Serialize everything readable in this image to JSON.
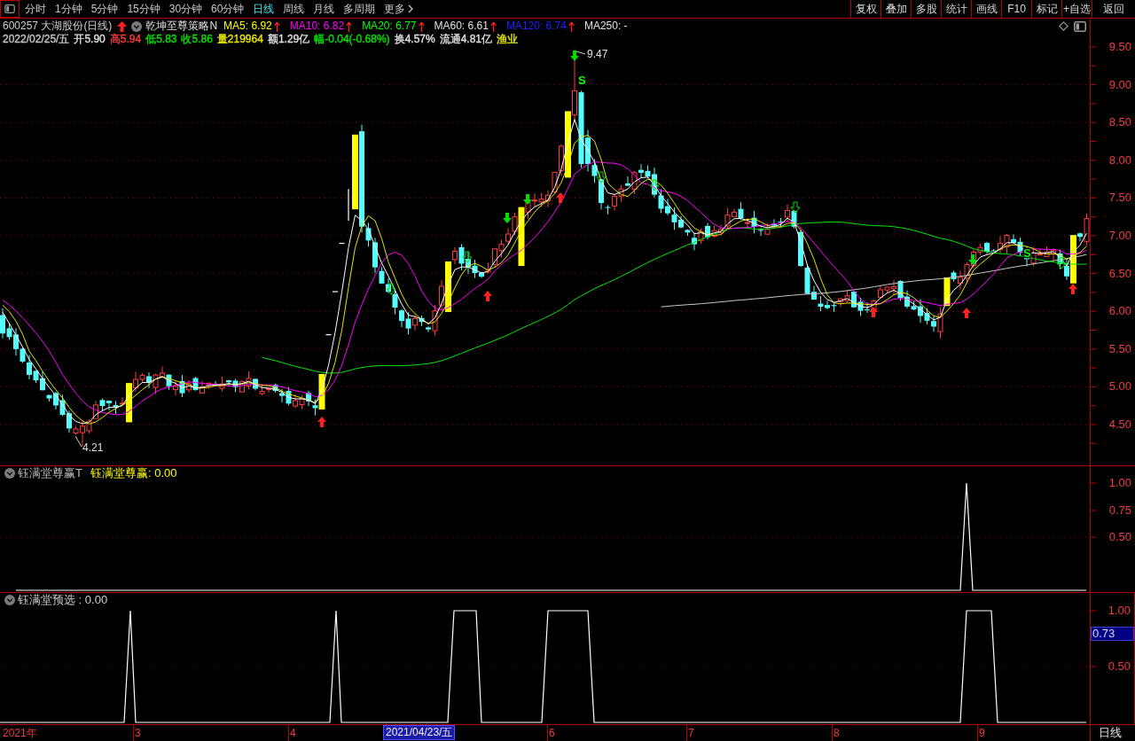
{
  "toolbar": {
    "periods": [
      {
        "label": "分时",
        "selected": false
      },
      {
        "label": "1分钟",
        "selected": false
      },
      {
        "label": "5分钟",
        "selected": false
      },
      {
        "label": "15分钟",
        "selected": false
      },
      {
        "label": "30分钟",
        "selected": false
      },
      {
        "label": "60分钟",
        "selected": false
      },
      {
        "label": "日线",
        "selected": true
      },
      {
        "label": "周线",
        "selected": false
      },
      {
        "label": "月线",
        "selected": false
      },
      {
        "label": "多周期",
        "selected": false
      }
    ],
    "more": "更多",
    "tools": [
      "复权",
      "叠加",
      "多股",
      "统计",
      "画线",
      "F10",
      "标记",
      "+自选",
      "返回"
    ]
  },
  "header": {
    "stock": "600257 大湖股份(日线)",
    "strategy": "乾坤至尊策略N",
    "averages": [
      {
        "label": "MA5: 6.92",
        "color": "#ffff00",
        "rising": true
      },
      {
        "label": "MA10: 6.82",
        "color": "#ff00ff",
        "rising": true
      },
      {
        "label": "MA20: 6.77",
        "color": "#00ff00",
        "rising": true
      },
      {
        "label": "MA60: 6.61",
        "color": "#e0e0e0",
        "rising": true
      },
      {
        "label": "MA120: 6.74",
        "color": "#2020ff",
        "rising": true
      },
      {
        "label": "MA250: -",
        "color": "#e0e0e0",
        "rising": false
      }
    ]
  },
  "quote": [
    {
      "text": "2022/02/25/五",
      "color": "#c8c8c8"
    },
    {
      "text": "开5.90",
      "color": "#e0e0e0"
    },
    {
      "text": "高5.94",
      "color": "#ff3c3c"
    },
    {
      "text": "低5.83",
      "color": "#00e600"
    },
    {
      "text": "收5.86",
      "color": "#00e600"
    },
    {
      "text": "量219964",
      "color": "#e6e600"
    },
    {
      "text": "额1.29亿",
      "color": "#e0e0e0"
    },
    {
      "text": "幅-0.04(-0.68%)",
      "color": "#00e600"
    },
    {
      "text": "换4.57%",
      "color": "#e0e0e0"
    },
    {
      "text": "流通4.81亿",
      "color": "#e0e0e0"
    },
    {
      "text": "渔业",
      "color": "#e6e600"
    }
  ],
  "price_chart": {
    "axis": [
      "9.50",
      "9.00",
      "8.50",
      "8.00",
      "7.50",
      "7.00",
      "6.50",
      "6.00",
      "5.50",
      "5.00",
      "4.50"
    ],
    "annotations": [
      "9.47",
      "4.21"
    ],
    "signal_letters": [
      "S",
      "S"
    ]
  },
  "indicator_1": {
    "name": "钰满堂尊赢T",
    "reading": "钰满堂尊赢: 0.00",
    "axis": [
      "1.00",
      "0.75",
      "0.50"
    ]
  },
  "indicator_2": {
    "name": "钰满堂预选 : 0.00",
    "axis": [
      "1.00",
      "0.50"
    ],
    "cursor_value": "0.73"
  },
  "date_axis": {
    "labels": [
      "2021年",
      "3",
      "4",
      "6",
      "7",
      "8",
      "9"
    ],
    "cursor_date": "2021/04/23/五",
    "period": "日线"
  }
}
